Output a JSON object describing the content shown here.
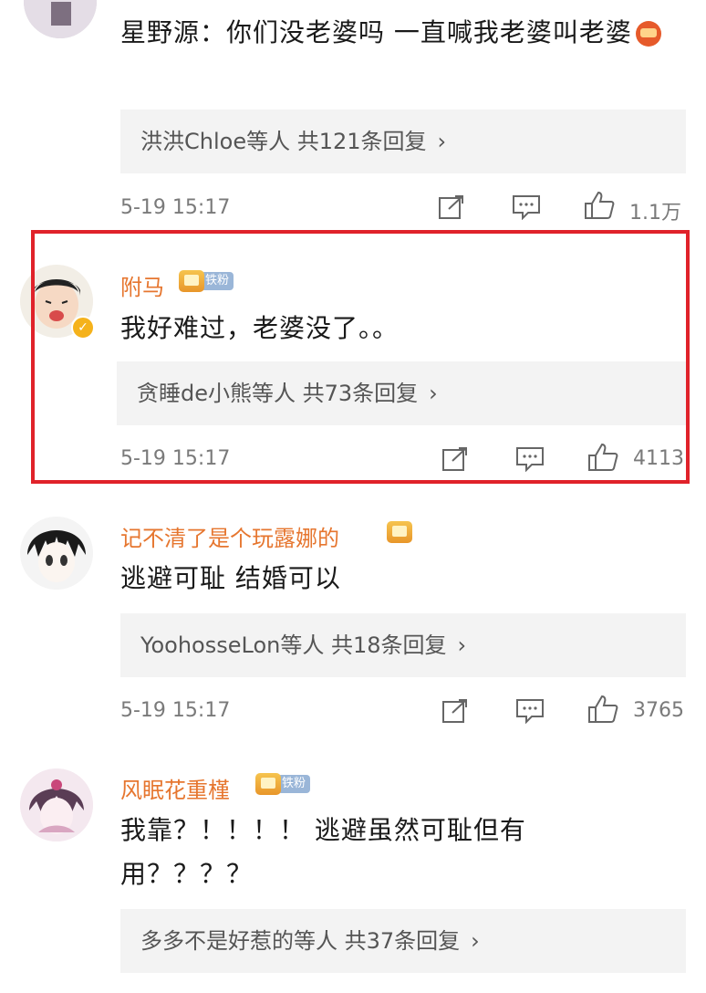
{
  "comments": [
    {
      "username": "",
      "text": "星野源：你们没老婆吗 一直喊我老婆叫老婆",
      "has_emoji": true,
      "reply_summary": "洪洪Chloe等人 共121条回复",
      "time": "5-19 15:17",
      "likes": "1.1万"
    },
    {
      "username": "附马",
      "fan_tag": "铁粉",
      "text": "我好难过，老婆没了。。",
      "reply_summary": "贪睡de小熊等人 共73条回复",
      "time": "5-19 15:17",
      "likes": "4113"
    },
    {
      "username": "记不清了是个玩露娜的",
      "text": "逃避可耻 结婚可以",
      "reply_summary": "YoohosseLon等人 共18条回复",
      "time": "5-19 15:17",
      "likes": "3765"
    },
    {
      "username": "风眠花重槿",
      "fan_tag": "铁粉",
      "text": "我靠？！！！！ 逃避虽然可耻但有用？？？？",
      "reply_summary": "多多不是好惹的等人 共37条回复"
    }
  ],
  "icons": {
    "share": "share-icon",
    "comment": "comment-icon",
    "like": "thumbs-up-icon",
    "chevron": "chevron-right-icon"
  },
  "colors": {
    "username": "#e6762f",
    "highlight_border": "#e0222a",
    "reply_bg": "#f3f3f3"
  }
}
